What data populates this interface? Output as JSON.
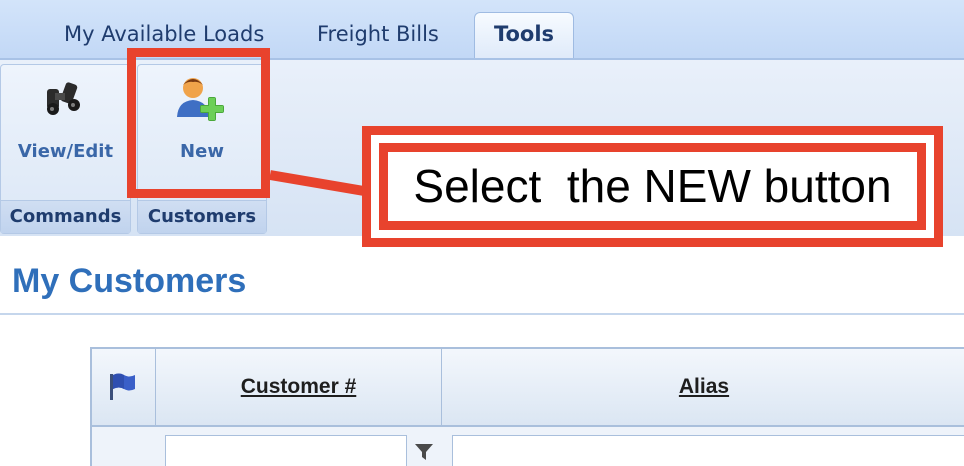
{
  "tabs": [
    {
      "label": "My Available Loads"
    },
    {
      "label": "Freight Bills"
    },
    {
      "label": "Tools",
      "active": true
    }
  ],
  "ribbon": {
    "groups": [
      {
        "label": "Commands",
        "commands": [
          {
            "label": "View/Edit",
            "icon": "binoculars-icon"
          }
        ]
      },
      {
        "label": "Customers",
        "commands": [
          {
            "label": "New",
            "icon": "add-user-icon"
          }
        ]
      }
    ]
  },
  "annotation": {
    "text": "Select  the NEW button",
    "color": "#e8432d"
  },
  "page": {
    "title": "My Customers"
  },
  "grid": {
    "columns": [
      {
        "label": "",
        "icon": "flag-icon"
      },
      {
        "label": "Customer #"
      },
      {
        "label": "Alias"
      }
    ],
    "filter_icon": "funnel-icon"
  },
  "colors": {
    "accent": "#2f6fba",
    "tab_text": "#1f3c6e",
    "tab_strip": "#c2d8f6"
  }
}
